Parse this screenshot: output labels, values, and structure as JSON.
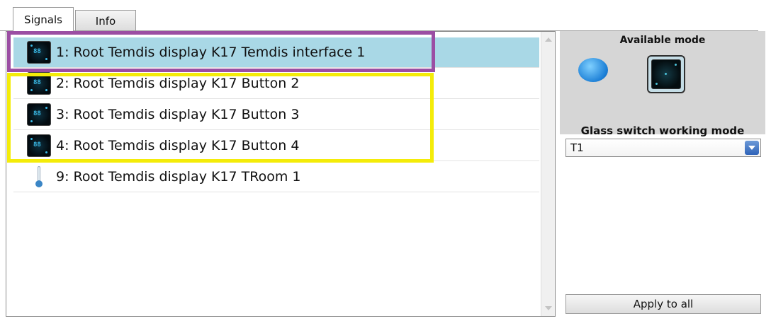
{
  "tabs": [
    {
      "label": "Signals",
      "active": true
    },
    {
      "label": "Info",
      "active": false
    }
  ],
  "signals": [
    {
      "label": "1: Root Temdis display K17 Temdis interface 1",
      "icon": "temdis-display-icon",
      "selected": true
    },
    {
      "label": "2: Root Temdis display K17 Button 2",
      "icon": "temdis-display-icon",
      "selected": false
    },
    {
      "label": "3: Root Temdis display K17 Button 3",
      "icon": "temdis-display-icon",
      "selected": false
    },
    {
      "label": "4: Root Temdis display K17 Button 4",
      "icon": "temdis-display-icon",
      "selected": false
    },
    {
      "label": "9: Root Temdis display K17 TRoom 1",
      "icon": "thermometer-icon",
      "selected": false
    }
  ],
  "mode_panel": {
    "header": "Available mode",
    "modes": [
      {
        "icon": "push-button-icon",
        "selected": false
      },
      {
        "icon": "glass-switch-icon",
        "selected": true
      }
    ],
    "working_mode_label": "Glass switch working mode",
    "working_mode_value": "T1",
    "apply_label": "Apply to all"
  },
  "colors": {
    "selection": "#a9d8e6",
    "highlight_purple": "#9b4ea3",
    "highlight_yellow": "#f4ec09"
  }
}
